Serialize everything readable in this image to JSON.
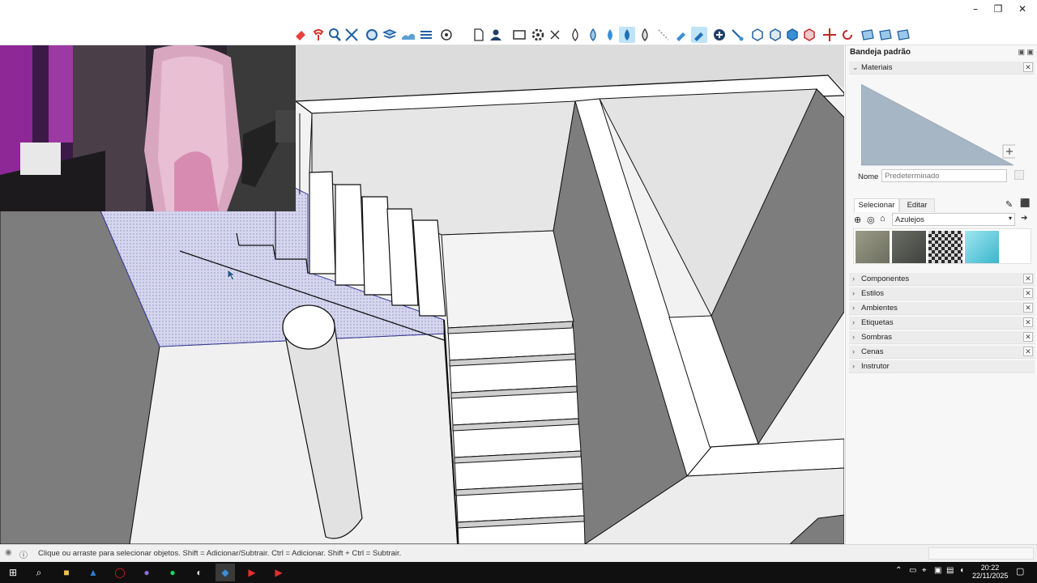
{
  "window": {
    "minimize": "–",
    "maximize": "❐",
    "close": "✕"
  },
  "tray": {
    "title": "Bandeja padrão",
    "materials": {
      "section_label": "Materiais",
      "name_label": "Nome",
      "name_placeholder": "Predeterminado",
      "tabs": [
        "Selecionar",
        "Editar"
      ],
      "library": "Azulejos",
      "swatch_names": [
        "stone-tile",
        "dark-stone-tile",
        "checker-tile",
        "blue-ice-tile"
      ]
    },
    "sections": [
      "Componentes",
      "Estilos",
      "Ambientes",
      "Etiquetas",
      "Sombras",
      "Cenas",
      "Instrutor"
    ]
  },
  "status": {
    "message": "Clique ou arraste para selecionar objetos. Shift = Adicionar/Subtrair. Ctrl = Adicionar. Shift + Ctrl = Subtrair."
  },
  "clock": {
    "time": "20:22",
    "date": "22/11/2025"
  },
  "colors": {
    "accent": "#3a8fd6",
    "selection": "#c9c9ee",
    "wall_dark": "#7d7d7d"
  }
}
